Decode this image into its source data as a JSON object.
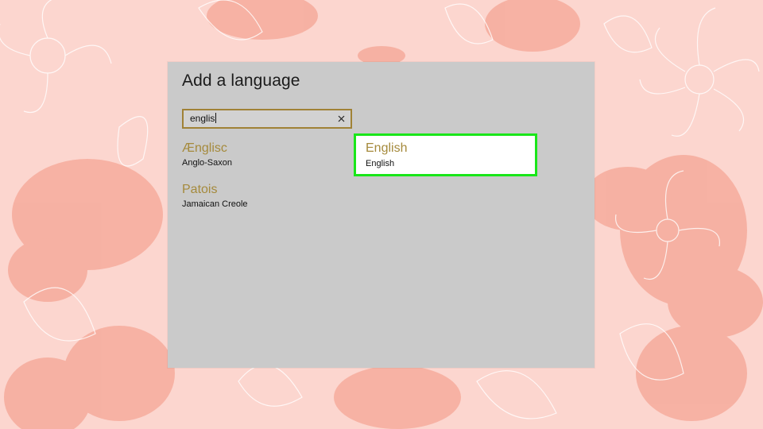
{
  "dialog": {
    "title": "Add a language"
  },
  "search": {
    "value": "englis",
    "clear_icon": "close-icon"
  },
  "results": [
    {
      "name": "Ænglisc",
      "native": "Anglo-Saxon",
      "selected": false
    },
    {
      "name": "Patois",
      "native": "Jamaican Creole",
      "selected": false
    },
    {
      "name": "English",
      "native": "English",
      "selected": true
    }
  ],
  "colors": {
    "accent": "#a58a3c",
    "selection_highlight": "#19e619",
    "dialog_bg": "#cacaca",
    "wallpaper_bg": "#fcd6cf",
    "wallpaper_flower": "#f7b1a4"
  }
}
